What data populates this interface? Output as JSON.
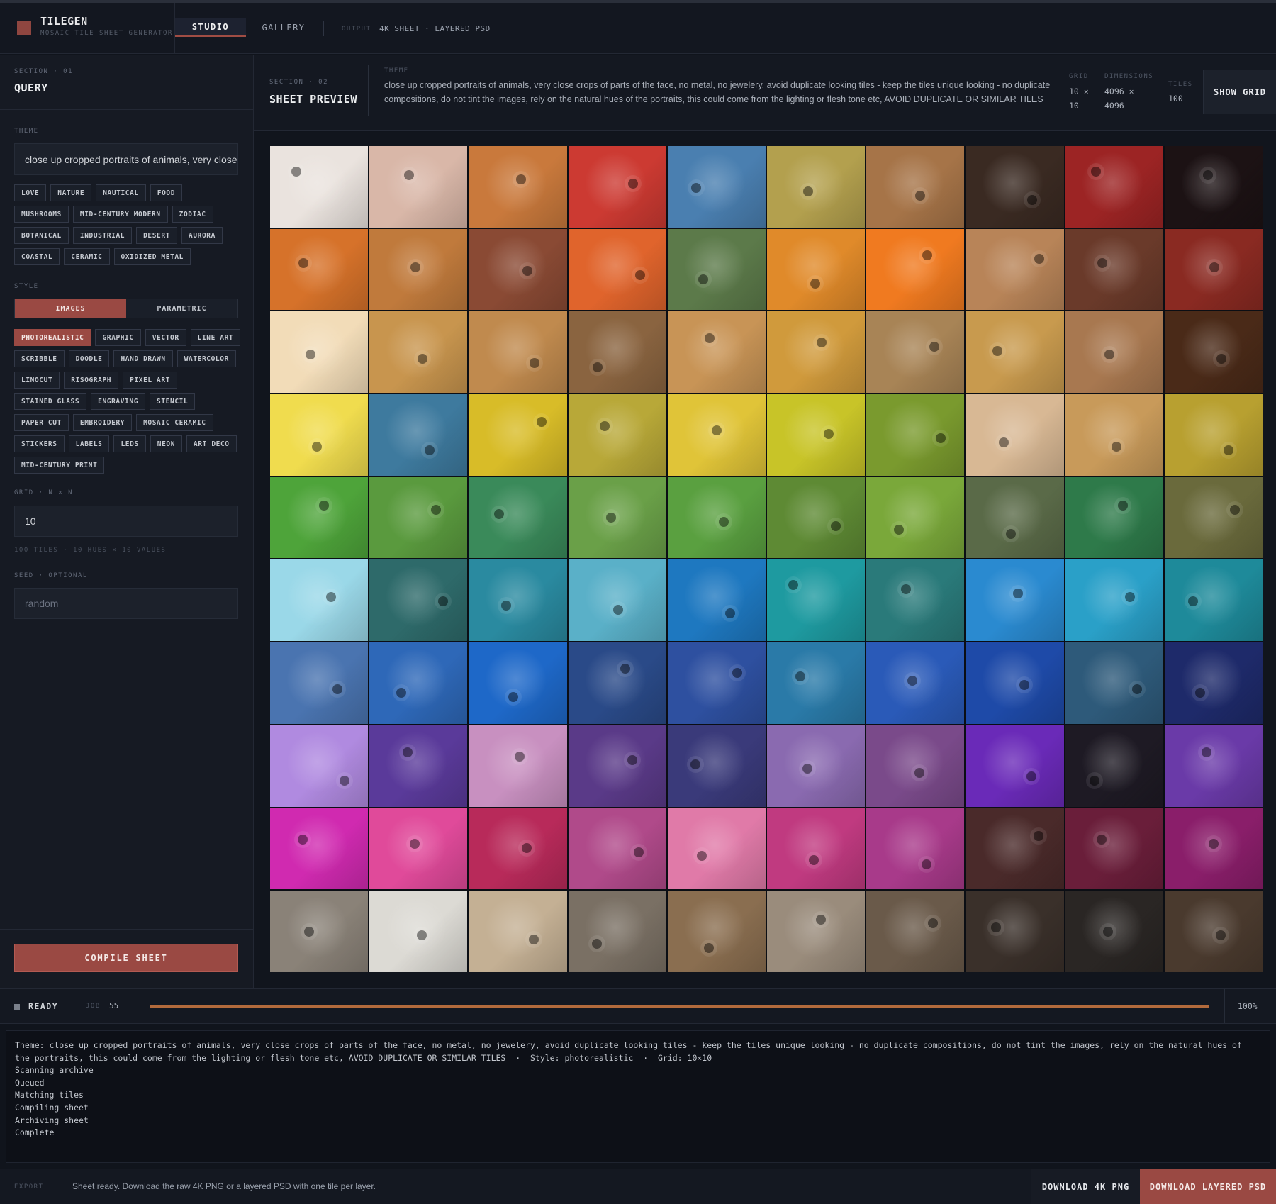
{
  "app": {
    "name": "TILEGEN",
    "subtitle": "MOSAIC TILE SHEET GENERATOR",
    "brand_color": "#9a4943"
  },
  "nav": {
    "tabs": [
      {
        "label": "STUDIO",
        "active": true
      },
      {
        "label": "GALLERY",
        "active": false
      }
    ],
    "output_label": "OUTPUT",
    "output_value": "4K SHEET · LAYERED PSD"
  },
  "query": {
    "section_label": "SECTION · 01",
    "title": "QUERY",
    "theme_label": "THEME",
    "theme_value": "close up cropped portraits of animals, very close crops of parts of the face, no metal, no jewelery, avoid duplicate looking tiles - keep the tiles unique looking - no duplicate compositions, do not tint the images, rely on the natural hues of the portraits, this could come from the lighting or flesh tone etc, AVOID DUPLICATE OR SIMILAR TILES",
    "theme_chip_rows": [
      [
        "LOVE",
        "NATURE",
        "NAUTICAL",
        "FOOD"
      ],
      [
        "MUSHROOMS",
        "MID-CENTURY MODERN",
        "ZODIAC"
      ],
      [
        "BOTANICAL",
        "INDUSTRIAL",
        "DESERT",
        "AURORA"
      ],
      [
        "COASTAL",
        "CERAMIC",
        "OXIDIZED METAL"
      ]
    ],
    "style_label": "STYLE",
    "style_modes": [
      {
        "label": "IMAGES",
        "active": true
      },
      {
        "label": "PARAMETRIC",
        "active": false
      }
    ],
    "style_chip_rows": [
      [
        "PHOTOREALISTIC",
        "GRAPHIC",
        "VECTOR",
        "LINE ART"
      ],
      [
        "SCRIBBLE",
        "DOODLE",
        "HAND DRAWN",
        "WATERCOLOR"
      ],
      [
        "LINOCUT",
        "RISOGRAPH",
        "PIXEL ART"
      ],
      [
        "STAINED GLASS",
        "ENGRAVING",
        "STENCIL"
      ],
      [
        "PAPER CUT",
        "EMBROIDERY",
        "MOSAIC CERAMIC"
      ],
      [
        "STICKERS",
        "LABELS",
        "LEDS",
        "NEON",
        "ART DECO"
      ],
      [
        "MID-CENTURY PRINT"
      ]
    ],
    "active_style": "PHOTOREALISTIC",
    "grid_label": "GRID · N × N",
    "grid_value": "10",
    "grid_hint": "100 TILES · 10 HUES × 10 VALUES",
    "seed_label": "SEED · OPTIONAL",
    "seed_placeholder": "random",
    "compile_label": "COMPILE SHEET"
  },
  "preview": {
    "section_label": "SECTION · 02",
    "title": "SHEET PREVIEW",
    "theme_label": "THEME",
    "theme_text": "close up cropped portraits of animals, very close crops of parts of the face, no metal, no jewelery, avoid duplicate looking tiles - keep the tiles unique looking - no duplicate compositions, do not tint the images, rely on the natural hues of the portraits, this could come from the lighting or flesh tone etc, AVOID DUPLICATE OR SIMILAR TILES",
    "grid_label": "GRID",
    "grid_line1": "10 ×",
    "grid_line2": "10",
    "dims_label": "DIMENSIONS",
    "dims_line1": "4096 ×",
    "dims_line2": "4096",
    "tiles_label": "TILES",
    "tiles_value": "100",
    "show_grid_label": "SHOW GRID",
    "tile_colors": [
      [
        "#eae3de",
        "#d9b7a8",
        "#c9793c",
        "#cc3a32",
        "#4a7fb0",
        "#b3a04e",
        "#a67448",
        "#3a2a22",
        "#9c2424",
        "#1c1214"
      ],
      [
        "#d6722a",
        "#c07a3c",
        "#8a4a34",
        "#e0642c",
        "#5c7a4a",
        "#e08a2a",
        "#f07a20",
        "#b88458",
        "#6a3a2a",
        "#8a2a22"
      ],
      [
        "#f2dcb8",
        "#c8954e",
        "#c08a4e",
        "#8a6440",
        "#c89456",
        "#d09a3c",
        "#a88456",
        "#c89a4e",
        "#a87850",
        "#4a2a18"
      ],
      [
        "#f0dc4e",
        "#3e7a9e",
        "#d8bc28",
        "#b8a838",
        "#e0c438",
        "#c8c428",
        "#7a9a2e",
        "#d8b894",
        "#c89a5a",
        "#b8a030"
      ],
      [
        "#4ea43a",
        "#5a9a3e",
        "#3a8a5a",
        "#6aa048",
        "#5aa040",
        "#5e8a34",
        "#7aa83a",
        "#5a6a48",
        "#2e7a4a",
        "#6a6a3c"
      ],
      [
        "#9ad8e8",
        "#2e6a6a",
        "#2a8aa0",
        "#5ab0c8",
        "#1e78c0",
        "#1e9aa0",
        "#2a7a7a",
        "#2a8ad0",
        "#2aa0c8",
        "#1e8a9a"
      ],
      [
        "#4a74b0",
        "#2e68b8",
        "#1e68c8",
        "#2a4a88",
        "#2e50a0",
        "#2a7aa8",
        "#2a5ab8",
        "#1e4aa8",
        "#2e5a7a",
        "#1e2a6a"
      ],
      [
        "#b08ae0",
        "#5a3a9a",
        "#c890c0",
        "#5a3a88",
        "#3a3a7a",
        "#8a6ab0",
        "#7a4a8a",
        "#6a2ab8",
        "#1e1a24",
        "#6a3aa8"
      ],
      [
        "#d02ab0",
        "#e04a9a",
        "#b82a5a",
        "#b04a8a",
        "#e07aa8",
        "#c03a80",
        "#a83a8a",
        "#4a2a2a",
        "#6a1e3a",
        "#8a1e6a"
      ],
      [
        "#8a8278",
        "#dcdad4",
        "#c4b094",
        "#7a7064",
        "#8a6e50",
        "#9a8c7c",
        "#6a5a4a",
        "#3a302a",
        "#2a2624",
        "#4a3a2e"
      ]
    ]
  },
  "status": {
    "state": "READY",
    "job_label": "JOB",
    "job_value": "55",
    "progress": 1.0,
    "percent_label": "100%",
    "progress_color": "#b26a3c"
  },
  "log": {
    "lines": [
      "Theme: close up cropped portraits of animals, very close crops of parts of the face, no metal, no jewelery, avoid duplicate looking tiles - keep the tiles unique looking - no duplicate compositions, do not tint the images, rely on the natural hues of the portraits, this could come from the lighting or flesh tone etc, AVOID DUPLICATE OR SIMILAR TILES  ·  Style: photorealistic  ·  Grid: 10×10",
      "Scanning archive",
      "Queued",
      "Matching tiles",
      "Compiling sheet",
      "Archiving sheet",
      "Complete"
    ]
  },
  "footer": {
    "export_label": "EXPORT",
    "message": "Sheet ready. Download the raw 4K PNG or a layered PSD with one tile per layer.",
    "download_png_label": "DOWNLOAD 4K PNG",
    "download_psd_label": "DOWNLOAD LAYERED PSD"
  }
}
